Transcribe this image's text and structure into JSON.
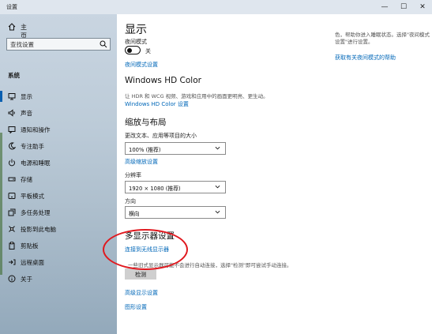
{
  "window": {
    "title": "设置",
    "minimize": "—",
    "maximize": "☐",
    "close": "✕"
  },
  "sidebar": {
    "home": "主页",
    "search_placeholder": "查找设置",
    "section": "系统",
    "items": [
      {
        "label": "显示",
        "icon": "monitor-icon"
      },
      {
        "label": "声音",
        "icon": "speaker-icon"
      },
      {
        "label": "通知和操作",
        "icon": "notification-icon"
      },
      {
        "label": "专注助手",
        "icon": "moon-icon"
      },
      {
        "label": "电源和睡眠",
        "icon": "power-icon"
      },
      {
        "label": "存储",
        "icon": "storage-icon"
      },
      {
        "label": "平板模式",
        "icon": "tablet-icon"
      },
      {
        "label": "多任务处理",
        "icon": "multitask-icon"
      },
      {
        "label": "投影到此电脑",
        "icon": "projection-icon"
      },
      {
        "label": "剪贴板",
        "icon": "clipboard-icon"
      },
      {
        "label": "远程桌面",
        "icon": "remote-desktop-icon"
      },
      {
        "label": "关于",
        "icon": "info-icon"
      }
    ]
  },
  "content": {
    "title": "显示",
    "night_light": {
      "label": "夜间模式",
      "state": "关",
      "settings_link": "夜间模式设置"
    },
    "side_note": {
      "text": "色，帮助你进入睡眠状态。选择\"夜间模式设置\"进行设置。",
      "link": "获取有关夜间模式的帮助"
    },
    "hd_color": {
      "heading": "Windows HD Color",
      "desc": "让 HDR 和 WCG 视频、游戏和应用中的画面更明亮、更生动。",
      "link": "Windows HD Color 设置"
    },
    "scale": {
      "heading": "缩放与布局",
      "change_label": "更改文本、应用等项目的大小",
      "change_value": "100% (推荐)",
      "advanced_link": "高级缩放设置",
      "resolution_label": "分辨率",
      "resolution_value": "1920 × 1080 (推荐)",
      "orientation_label": "方向",
      "orientation_value": "横向"
    },
    "multi": {
      "heading": "多显示器设置",
      "connect_link": "连接到无线显示器",
      "desc": "一些旧式显示器可能不会进行自动连接，选择\"检测\"即可尝试手动连接。",
      "detect_button": "检测"
    },
    "advanced_display_link": "高级显示设置",
    "graphics_link": "图形设置"
  },
  "colors": {
    "accent": "#0067b8",
    "annotation": "#e0191f"
  }
}
